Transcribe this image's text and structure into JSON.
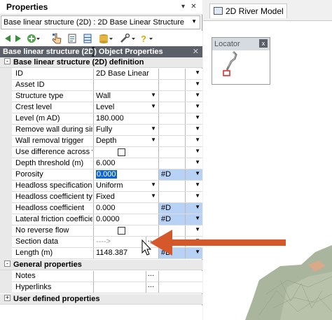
{
  "panel": {
    "title": "Properties",
    "object_selector": "Base linear structure (2D) : 2D Base Linear Structure :",
    "caption": "Base linear structure (2D) Object Properties"
  },
  "toolbar_icons": [
    "back-arrow-icon",
    "forward-arrow-icon",
    "add-icon",
    "pointer-icon",
    "page-icon",
    "table-icon",
    "database-icon",
    "wrench-icon",
    "help-icon"
  ],
  "categories": [
    {
      "label": "Base linear structure (2D) definition",
      "toggle": "-"
    },
    {
      "label": "General properties",
      "toggle": "-"
    },
    {
      "label": "User defined properties",
      "toggle": "+"
    }
  ],
  "rows": [
    {
      "name": "ID",
      "value": "2D Base Linear"
    },
    {
      "name": "Asset ID",
      "value": ""
    },
    {
      "name": "Structure type",
      "value": "Wall"
    },
    {
      "name": "Crest level",
      "value": "Level"
    },
    {
      "name": "Level (m AD)",
      "value": "180.000"
    },
    {
      "name": "Remove wall during simulation",
      "value": "Fully"
    },
    {
      "name": "Wall removal trigger",
      "value": "Depth"
    },
    {
      "name": "Use difference across wall",
      "value": ""
    },
    {
      "name": "Depth threshold (m)",
      "value": "6.000"
    },
    {
      "name": "Porosity",
      "value": "0.000",
      "flag": "#D"
    },
    {
      "name": "Headloss specification",
      "value": "Uniform"
    },
    {
      "name": "Headloss coefficient type",
      "value": "Fixed"
    },
    {
      "name": "Headloss coefficient",
      "value": "0.000",
      "flag": "#D"
    },
    {
      "name": "Lateral friction coefficient",
      "value": "0.0000",
      "flag": "#D"
    },
    {
      "name": "No reverse flow",
      "value": ""
    },
    {
      "name": "Section data",
      "value": "---->"
    },
    {
      "name": "Length (m)",
      "value": "1148.387",
      "flag": "#D"
    }
  ],
  "general_rows": [
    {
      "name": "Notes",
      "value": ""
    },
    {
      "name": "Hyperlinks",
      "value": ""
    }
  ],
  "ellipsis": "...",
  "right": {
    "tab_label": "2D River Model",
    "locator_title": "Locator",
    "locator_close": "x"
  },
  "colors": {
    "caption_bg": "#5b6068",
    "flag_cell": "#b8d2f5",
    "selection": "#0a64d6",
    "callout_arrow": "#d4582a",
    "terrain": "#a7b49a"
  }
}
